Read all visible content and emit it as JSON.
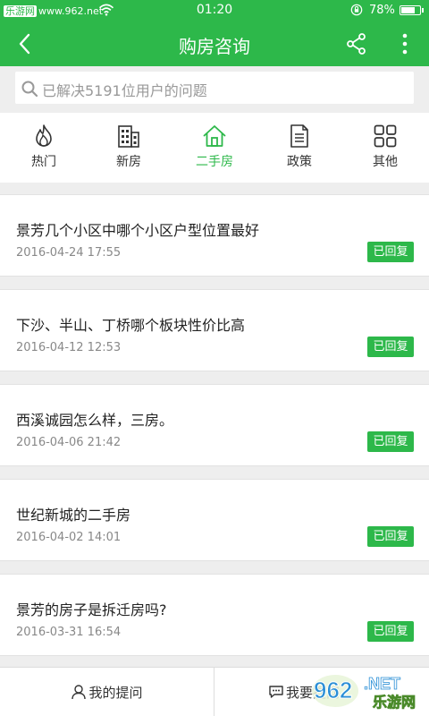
{
  "status_bar": {
    "carrier_brand": "乐游网",
    "carrier_url": "www.962.net",
    "time": "01:20",
    "battery": "78%",
    "battery_level": 0.78
  },
  "header": {
    "title": "购房咨询"
  },
  "search": {
    "placeholder": "已解决5191位用户的问题"
  },
  "categories": [
    {
      "label": "热门",
      "icon": "flame-icon"
    },
    {
      "label": "新房",
      "icon": "building-icon"
    },
    {
      "label": "二手房",
      "icon": "house-icon",
      "active": true
    },
    {
      "label": "政策",
      "icon": "document-icon"
    },
    {
      "label": "其他",
      "icon": "grid-icon"
    }
  ],
  "questions": [
    {
      "title": "景芳几个小区中哪个小区户型位置最好",
      "date": "2016-04-24 17:55",
      "status": "已回复"
    },
    {
      "title": "下沙、半山、丁桥哪个板块性价比高",
      "date": "2016-04-12 12:53",
      "status": "已回复"
    },
    {
      "title": "西溪诚园怎么样，三房。",
      "date": "2016-04-06 21:42",
      "status": "已回复"
    },
    {
      "title": "世纪新城的二手房",
      "date": "2016-04-02 14:01",
      "status": "已回复"
    },
    {
      "title": "景芳的房子是拆迁房吗?",
      "date": "2016-03-31 16:54",
      "status": "已回复"
    }
  ],
  "bottom_bar": {
    "my_questions": "我的提问",
    "ask_partial": "我要提问"
  },
  "watermark": {
    "text1": "962",
    "text2": ".NET",
    "text3": "乐游网"
  },
  "colors": {
    "accent": "#2db84a"
  }
}
